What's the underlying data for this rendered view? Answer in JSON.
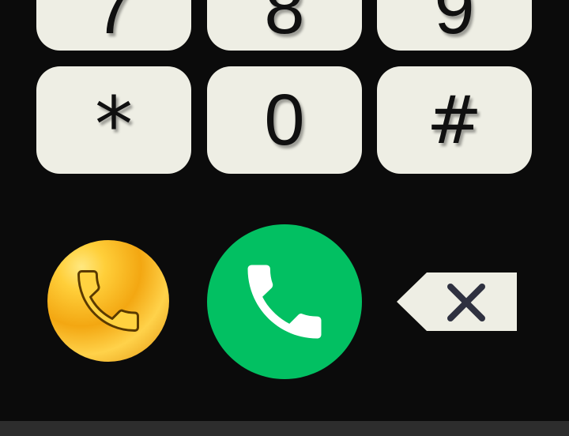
{
  "keypad": {
    "top_row": [
      "7",
      "8",
      "9"
    ],
    "bottom_row": [
      "*",
      "0",
      "#"
    ]
  },
  "actions": {
    "alt_call_icon": "phone-handset-icon",
    "call_icon": "phone-handset-icon",
    "delete_icon": "backspace-icon"
  },
  "colors": {
    "key_background": "#eeeee4",
    "call_green": "#02c062",
    "alt_call_gold": "#f3a712",
    "background": "#0b0b0b"
  }
}
